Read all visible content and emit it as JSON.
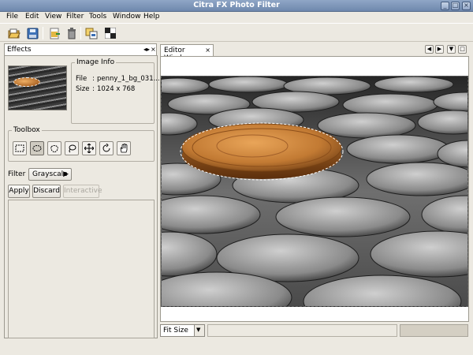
{
  "window": {
    "title": "Citra FX Photo Filter"
  },
  "menu": [
    "File",
    "Edit",
    "View",
    "Filter",
    "Tools",
    "Window",
    "Help"
  ],
  "toolbar": {
    "buttons": [
      "open-icon",
      "save-icon",
      "export-icon",
      "delete-icon",
      "copy-icon",
      "checker-icon"
    ]
  },
  "effects_panel": {
    "tab_label": "Effects",
    "image_info": {
      "legend": "Image Info",
      "file_label": "File",
      "file_value": "penny_1_bg_031...",
      "size_label": "Size",
      "size_value": "1024 x 768"
    },
    "toolbox": {
      "legend": "Toolbox",
      "tools": [
        "rect-select-icon",
        "ellipse-select-icon",
        "freeform-select-icon",
        "lasso-icon",
        "move-icon",
        "rotate-icon",
        "hand-icon"
      ],
      "active_tool": "ellipse-select-icon"
    },
    "filter": {
      "label": "Filter",
      "value": "Grayscale"
    },
    "buttons": {
      "apply": "Apply",
      "discard": "Discard",
      "interactive": "Interactive"
    }
  },
  "editor": {
    "tab_label": "Editor Window",
    "zoom": "Fit Size"
  },
  "colors": {
    "title_bar": "#7890b5",
    "coin": "#c47a35",
    "background": "#ece9e1"
  }
}
